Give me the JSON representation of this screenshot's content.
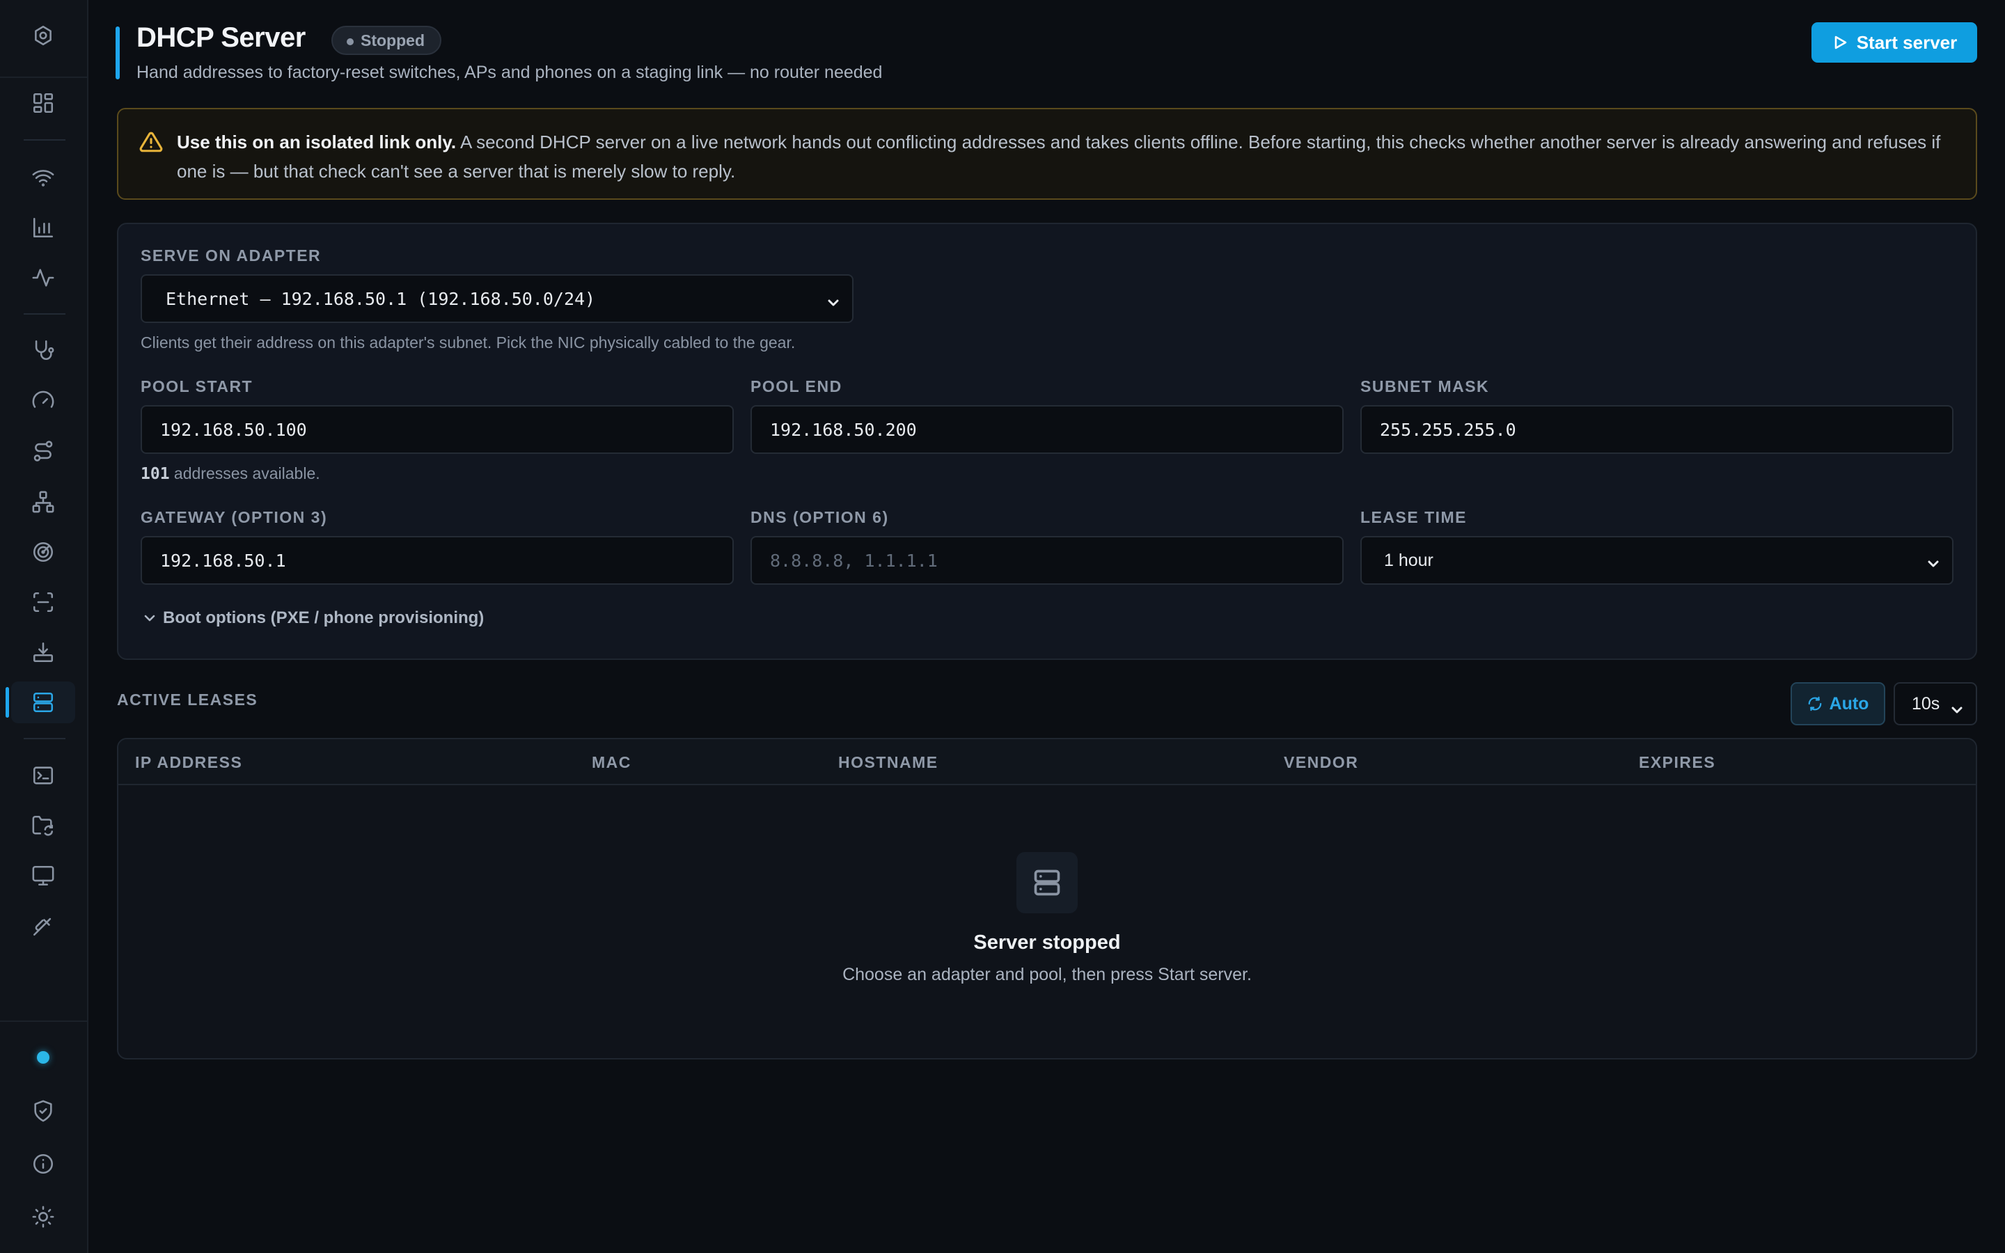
{
  "sidebar": {
    "items": [
      {
        "icon": "dashboard-icon"
      },
      {
        "icon": "wifi-icon"
      },
      {
        "icon": "bar-chart-icon"
      },
      {
        "icon": "activity-icon"
      },
      {
        "icon": "stethoscope-icon"
      },
      {
        "icon": "gauge-icon"
      },
      {
        "icon": "route-icon"
      },
      {
        "icon": "network-topology-icon"
      },
      {
        "icon": "radar-icon"
      },
      {
        "icon": "scan-icon"
      },
      {
        "icon": "download-icon"
      },
      {
        "icon": "server-icon",
        "active": true
      },
      {
        "icon": "terminal-icon"
      },
      {
        "icon": "folder-sync-icon"
      },
      {
        "icon": "monitor-icon"
      },
      {
        "icon": "plug-icon"
      }
    ],
    "footer": [
      {
        "icon": "status-dot"
      },
      {
        "icon": "shield-check-icon"
      },
      {
        "icon": "info-icon"
      },
      {
        "icon": "theme-sun-icon"
      }
    ]
  },
  "header": {
    "title": "DHCP Server",
    "status": "Stopped",
    "subtitle": "Hand addresses to factory-reset switches, APs and phones on a staging link — no router needed",
    "start_button": "Start server"
  },
  "warning": {
    "bold": "Use this on an isolated link only.",
    "text": " A second DHCP server on a live network hands out conflicting addresses and takes clients offline. Before starting, this checks whether another server is already answering and refuses if one is — but that check can't see a server that is merely slow to reply."
  },
  "config": {
    "adapter_label": "SERVE ON ADAPTER",
    "adapter_value": "Ethernet — 192.168.50.1 (192.168.50.0/24)",
    "adapter_hint": "Clients get their address on this adapter's subnet. Pick the NIC physically cabled to the gear.",
    "pool_start_label": "POOL START",
    "pool_start_value": "192.168.50.100",
    "pool_end_label": "POOL END",
    "pool_end_value": "192.168.50.200",
    "subnet_label": "SUBNET MASK",
    "subnet_value": "255.255.255.0",
    "available_count": "101",
    "available_text": " addresses available.",
    "gateway_label": "GATEWAY (OPTION 3)",
    "gateway_value": "192.168.50.1",
    "dns_label": "DNS (OPTION 6)",
    "dns_placeholder": "8.8.8.8, 1.1.1.1",
    "lease_label": "LEASE TIME",
    "lease_value": "1 hour",
    "boot_options": "Boot options (PXE / phone provisioning)"
  },
  "leases": {
    "title": "ACTIVE LEASES",
    "auto_label": "Auto",
    "interval": "10s",
    "columns": [
      "IP ADDRESS",
      "MAC",
      "HOSTNAME",
      "VENDOR",
      "EXPIRES"
    ],
    "rows": [],
    "empty_title": "Server stopped",
    "empty_text": "Choose an adapter and pool, then press Start server."
  },
  "colors": {
    "accent": "#0f9ee0",
    "warning": "#e7b43a",
    "background": "#0b0e13"
  }
}
